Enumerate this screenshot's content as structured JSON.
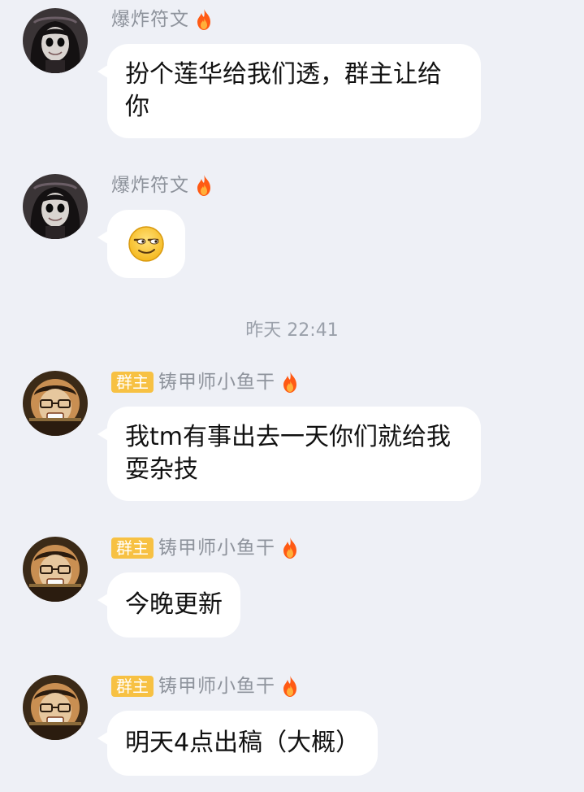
{
  "timestamp": "昨天 22:41",
  "messages": [
    {
      "sender": "爆炸符文",
      "badge": "",
      "text": "扮个莲华给我们透，群主让给你",
      "avatar": "gothic-girl-avatar",
      "emoji": ""
    },
    {
      "sender": "爆炸符文",
      "badge": "",
      "text": "",
      "avatar": "gothic-girl-avatar",
      "emoji": "smirk-emoji"
    },
    {
      "sender": "铸甲师小鱼干",
      "badge": "群主",
      "text": "我tm有事出去一天你们就给我耍杂技",
      "avatar": "glasses-man-avatar",
      "emoji": ""
    },
    {
      "sender": "铸甲师小鱼干",
      "badge": "群主",
      "text": "今晚更新",
      "avatar": "glasses-man-avatar",
      "emoji": ""
    },
    {
      "sender": "铸甲师小鱼干",
      "badge": "群主",
      "text": "明天4点出稿（大概）",
      "avatar": "glasses-man-avatar",
      "emoji": ""
    }
  ],
  "colors": {
    "background": "#eef0f6",
    "bubble": "#ffffff",
    "badge": "#f7c143",
    "name_text": "#8e939c",
    "flame": "#ff6a1a"
  }
}
